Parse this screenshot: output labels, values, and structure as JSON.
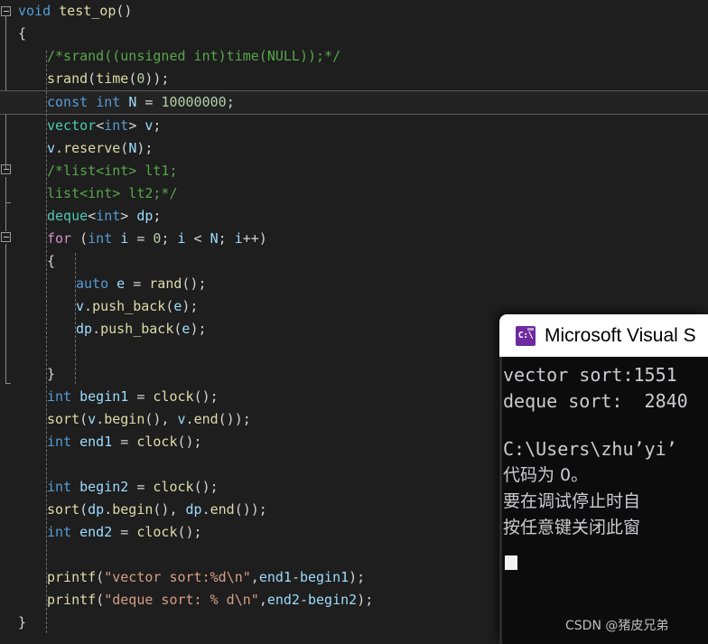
{
  "editor": {
    "background_color": "#1e1e1e",
    "current_line_number": 4,
    "lines": [
      {
        "indent": 0,
        "tokens": [
          {
            "t": "void ",
            "c": "k"
          },
          {
            "t": "test_op",
            "c": "fn"
          },
          {
            "t": "()",
            "c": "pun"
          }
        ]
      },
      {
        "indent": 0,
        "tokens": [
          {
            "t": "{",
            "c": "brc"
          }
        ]
      },
      {
        "indent": 1,
        "tokens": [
          {
            "t": "/*srand((unsigned int)time(NULL));*/",
            "c": "cmt"
          }
        ]
      },
      {
        "indent": 1,
        "tokens": [
          {
            "t": "srand",
            "c": "fn"
          },
          {
            "t": "(",
            "c": "pun"
          },
          {
            "t": "time",
            "c": "fn"
          },
          {
            "t": "(",
            "c": "pun"
          },
          {
            "t": "0",
            "c": "num"
          },
          {
            "t": "));",
            "c": "pun"
          }
        ]
      },
      {
        "indent": 1,
        "current": true,
        "tokens": [
          {
            "t": "const ",
            "c": "k"
          },
          {
            "t": "int ",
            "c": "k"
          },
          {
            "t": "N",
            "c": "var"
          },
          {
            "t": " = ",
            "c": "pun"
          },
          {
            "t": "10000000",
            "c": "num"
          },
          {
            "t": ";",
            "c": "pun"
          }
        ]
      },
      {
        "indent": 1,
        "tokens": [
          {
            "t": "vector",
            "c": "type"
          },
          {
            "t": "<",
            "c": "pun"
          },
          {
            "t": "int",
            "c": "k"
          },
          {
            "t": "> ",
            "c": "pun"
          },
          {
            "t": "v",
            "c": "var"
          },
          {
            "t": ";",
            "c": "pun"
          }
        ]
      },
      {
        "indent": 1,
        "tokens": [
          {
            "t": "v",
            "c": "var"
          },
          {
            "t": ".",
            "c": "pun"
          },
          {
            "t": "reserve",
            "c": "fn"
          },
          {
            "t": "(",
            "c": "pun"
          },
          {
            "t": "N",
            "c": "var"
          },
          {
            "t": ");",
            "c": "pun"
          }
        ]
      },
      {
        "indent": 1,
        "tokens": [
          {
            "t": "/*list<int> lt1;",
            "c": "cmt"
          }
        ]
      },
      {
        "indent": 1,
        "tokens": [
          {
            "t": "list<int> lt2;*/",
            "c": "cmt"
          }
        ]
      },
      {
        "indent": 1,
        "tokens": [
          {
            "t": "deque",
            "c": "type"
          },
          {
            "t": "<",
            "c": "pun"
          },
          {
            "t": "int",
            "c": "k"
          },
          {
            "t": "> ",
            "c": "pun"
          },
          {
            "t": "dp",
            "c": "var"
          },
          {
            "t": ";",
            "c": "pun"
          }
        ]
      },
      {
        "indent": 1,
        "tokens": [
          {
            "t": "for ",
            "c": "kctl"
          },
          {
            "t": "(",
            "c": "pun"
          },
          {
            "t": "int ",
            "c": "k"
          },
          {
            "t": "i",
            "c": "var"
          },
          {
            "t": " = ",
            "c": "pun"
          },
          {
            "t": "0",
            "c": "num"
          },
          {
            "t": "; ",
            "c": "pun"
          },
          {
            "t": "i",
            "c": "var"
          },
          {
            "t": " < ",
            "c": "pun"
          },
          {
            "t": "N",
            "c": "var"
          },
          {
            "t": "; ",
            "c": "pun"
          },
          {
            "t": "i",
            "c": "var"
          },
          {
            "t": "++)",
            "c": "pun"
          }
        ]
      },
      {
        "indent": 1,
        "tokens": [
          {
            "t": "{",
            "c": "brc"
          }
        ]
      },
      {
        "indent": 2,
        "tokens": [
          {
            "t": "auto ",
            "c": "k"
          },
          {
            "t": "e",
            "c": "var"
          },
          {
            "t": " = ",
            "c": "pun"
          },
          {
            "t": "rand",
            "c": "fn"
          },
          {
            "t": "();",
            "c": "pun"
          }
        ]
      },
      {
        "indent": 2,
        "tokens": [
          {
            "t": "v",
            "c": "var"
          },
          {
            "t": ".",
            "c": "pun"
          },
          {
            "t": "push_back",
            "c": "fn"
          },
          {
            "t": "(",
            "c": "pun"
          },
          {
            "t": "e",
            "c": "var"
          },
          {
            "t": ");",
            "c": "pun"
          }
        ]
      },
      {
        "indent": 2,
        "tokens": [
          {
            "t": "dp",
            "c": "var"
          },
          {
            "t": ".",
            "c": "pun"
          },
          {
            "t": "push_back",
            "c": "fn"
          },
          {
            "t": "(",
            "c": "pun"
          },
          {
            "t": "e",
            "c": "var"
          },
          {
            "t": ");",
            "c": "pun"
          }
        ]
      },
      {
        "indent": 2,
        "tokens": []
      },
      {
        "indent": 1,
        "tokens": [
          {
            "t": "}",
            "c": "brc"
          }
        ]
      },
      {
        "indent": 1,
        "tokens": [
          {
            "t": "int ",
            "c": "k"
          },
          {
            "t": "begin1",
            "c": "var"
          },
          {
            "t": " = ",
            "c": "pun"
          },
          {
            "t": "clock",
            "c": "fn"
          },
          {
            "t": "();",
            "c": "pun"
          }
        ]
      },
      {
        "indent": 1,
        "tokens": [
          {
            "t": "sort",
            "c": "fn"
          },
          {
            "t": "(",
            "c": "pun"
          },
          {
            "t": "v",
            "c": "var"
          },
          {
            "t": ".",
            "c": "pun"
          },
          {
            "t": "begin",
            "c": "fn"
          },
          {
            "t": "(), ",
            "c": "pun"
          },
          {
            "t": "v",
            "c": "var"
          },
          {
            "t": ".",
            "c": "pun"
          },
          {
            "t": "end",
            "c": "fn"
          },
          {
            "t": "());",
            "c": "pun"
          }
        ]
      },
      {
        "indent": 1,
        "tokens": [
          {
            "t": "int ",
            "c": "k"
          },
          {
            "t": "end1",
            "c": "var"
          },
          {
            "t": " = ",
            "c": "pun"
          },
          {
            "t": "clock",
            "c": "fn"
          },
          {
            "t": "();",
            "c": "pun"
          }
        ]
      },
      {
        "indent": 1,
        "tokens": []
      },
      {
        "indent": 1,
        "tokens": [
          {
            "t": "int ",
            "c": "k"
          },
          {
            "t": "begin2",
            "c": "var"
          },
          {
            "t": " = ",
            "c": "pun"
          },
          {
            "t": "clock",
            "c": "fn"
          },
          {
            "t": "();",
            "c": "pun"
          }
        ]
      },
      {
        "indent": 1,
        "tokens": [
          {
            "t": "sort",
            "c": "fn"
          },
          {
            "t": "(",
            "c": "pun"
          },
          {
            "t": "dp",
            "c": "var"
          },
          {
            "t": ".",
            "c": "pun"
          },
          {
            "t": "begin",
            "c": "fn"
          },
          {
            "t": "(), ",
            "c": "pun"
          },
          {
            "t": "dp",
            "c": "var"
          },
          {
            "t": ".",
            "c": "pun"
          },
          {
            "t": "end",
            "c": "fn"
          },
          {
            "t": "());",
            "c": "pun"
          }
        ]
      },
      {
        "indent": 1,
        "tokens": [
          {
            "t": "int ",
            "c": "k"
          },
          {
            "t": "end2",
            "c": "var"
          },
          {
            "t": " = ",
            "c": "pun"
          },
          {
            "t": "clock",
            "c": "fn"
          },
          {
            "t": "();",
            "c": "pun"
          }
        ]
      },
      {
        "indent": 1,
        "tokens": []
      },
      {
        "indent": 1,
        "tokens": [
          {
            "t": "printf",
            "c": "fn"
          },
          {
            "t": "(",
            "c": "pun"
          },
          {
            "t": "\"vector sort:%d\\n\"",
            "c": "str"
          },
          {
            "t": ",",
            "c": "pun"
          },
          {
            "t": "end1",
            "c": "var"
          },
          {
            "t": "-",
            "c": "pun"
          },
          {
            "t": "begin1",
            "c": "var"
          },
          {
            "t": ");",
            "c": "pun"
          }
        ]
      },
      {
        "indent": 1,
        "tokens": [
          {
            "t": "printf",
            "c": "fn"
          },
          {
            "t": "(",
            "c": "pun"
          },
          {
            "t": "\"deque sort: % d\\n\"",
            "c": "str"
          },
          {
            "t": ",",
            "c": "pun"
          },
          {
            "t": "end2",
            "c": "var"
          },
          {
            "t": "-",
            "c": "pun"
          },
          {
            "t": "begin2",
            "c": "var"
          },
          {
            "t": ");",
            "c": "pun"
          }
        ]
      },
      {
        "indent": 0,
        "tokens": [
          {
            "t": "}",
            "c": "brc"
          }
        ]
      }
    ]
  },
  "console": {
    "title": "Microsoft Visual S",
    "icon": "command-prompt-icon",
    "icon_label": "C:\\",
    "output_lines": [
      {
        "text": "vector sort:1551",
        "cjk": false
      },
      {
        "text": "deque sort:  2840",
        "cjk": false
      },
      {
        "text": "",
        "cjk": false
      },
      {
        "text": "C:\\Users\\zhu’yi’",
        "cjk": false
      },
      {
        "text": "代码为 0。",
        "cjk": true
      },
      {
        "text": "要在调试停止时自",
        "cjk": true
      },
      {
        "text": "按任意键关闭此窗",
        "cjk": true
      }
    ],
    "cursor_visible": true
  },
  "watermark": {
    "text": "CSDN @猪皮兄弟"
  }
}
